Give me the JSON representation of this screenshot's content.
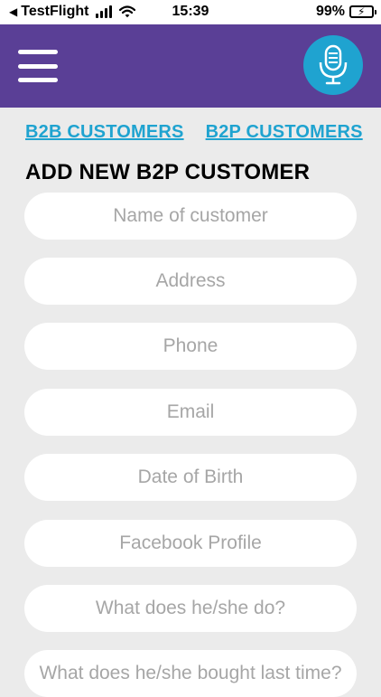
{
  "status_bar": {
    "back_app": "TestFlight",
    "time": "15:39",
    "battery": "99%"
  },
  "header": {
    "menu_icon": "hamburger-menu-icon",
    "mic_icon": "microphone-icon",
    "colors": {
      "background": "#5a3f96",
      "accent": "#1fa3d0"
    }
  },
  "tabs": [
    {
      "label": "B2B CUSTOMERS"
    },
    {
      "label": "B2P CUSTOMERS"
    }
  ],
  "title": "ADD NEW B2P CUSTOMER",
  "form": {
    "fields": [
      {
        "placeholder": "Name of customer",
        "value": ""
      },
      {
        "placeholder": "Address",
        "value": ""
      },
      {
        "placeholder": "Phone",
        "value": ""
      },
      {
        "placeholder": "Email",
        "value": ""
      },
      {
        "placeholder": "Date of Birth",
        "value": ""
      },
      {
        "placeholder": "Facebook Profile",
        "value": ""
      },
      {
        "placeholder": "What does he/she do?",
        "value": ""
      },
      {
        "placeholder": "What does he/she bought last time?",
        "value": ""
      }
    ]
  }
}
